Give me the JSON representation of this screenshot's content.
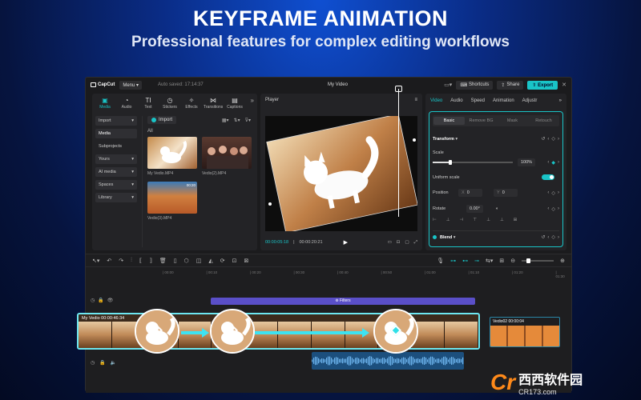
{
  "hero": {
    "title": "KEYFRAME ANIMATION",
    "subtitle": "Professional features for complex editing workflows"
  },
  "titlebar": {
    "logo": "CapCut",
    "menu": "Menu",
    "autosave": "Auto saved: 17:14:37",
    "doc_title": "My Video",
    "shortcuts": "Shortcuts",
    "share": "Share",
    "export": "Export"
  },
  "media": {
    "tabs": [
      {
        "label": "Media",
        "icon": "media-icon"
      },
      {
        "label": "Audio",
        "icon": "audio-icon"
      },
      {
        "label": "Text",
        "icon": "text-icon"
      },
      {
        "label": "Stickers",
        "icon": "stickers-icon"
      },
      {
        "label": "Effects",
        "icon": "effects-icon"
      },
      {
        "label": "Transitions",
        "icon": "transitions-icon"
      },
      {
        "label": "Captions",
        "icon": "captions-icon"
      }
    ],
    "side": [
      "Import",
      "Media",
      "Subprojects",
      "Yours",
      "AI media",
      "Spaces",
      "Library"
    ],
    "import_btn": "Import",
    "all_label": "All",
    "thumbs": [
      {
        "caption": "My Vedio.MP4",
        "time": ""
      },
      {
        "caption": "Vedio(2).MP4",
        "time": ""
      },
      {
        "caption": "Vedio(3).MP4",
        "time": "00:20"
      }
    ]
  },
  "player": {
    "title": "Player",
    "current": "00:00:05:18",
    "total": "00:00:20:21"
  },
  "props": {
    "tabs": [
      "Video",
      "Audio",
      "Speed",
      "Animation",
      "Adjustr"
    ],
    "sub_tabs": [
      "Basic",
      "Remove BG",
      "Mask",
      "Retouch"
    ],
    "transform": "Transform",
    "scale_label": "Scale",
    "scale_value": "100%",
    "uniform_scale": "Uniform scale",
    "position_label": "Position",
    "pos_x_label": "X",
    "pos_x": "0",
    "pos_y_label": "Y",
    "pos_y": "0",
    "rotate_label": "Rotate",
    "rotate_value": "0.00°",
    "blend": "Blend"
  },
  "timeline": {
    "ticks": [
      "00:00",
      "00:10",
      "00:20",
      "00:30",
      "00:40",
      "00:50",
      "01:00",
      "01:10",
      "01:20",
      "01:30"
    ],
    "filters": "Filters",
    "main_clip": "My Vedio  00:00:46:34",
    "v2_clip": "Vedio02  00:00:04"
  },
  "watermark": {
    "main": "西西软件园",
    "sub": "CR173.com"
  },
  "colors": {
    "accent": "#19c4c7",
    "filter": "#5a4fc8",
    "audio": "#1c4f7d"
  }
}
